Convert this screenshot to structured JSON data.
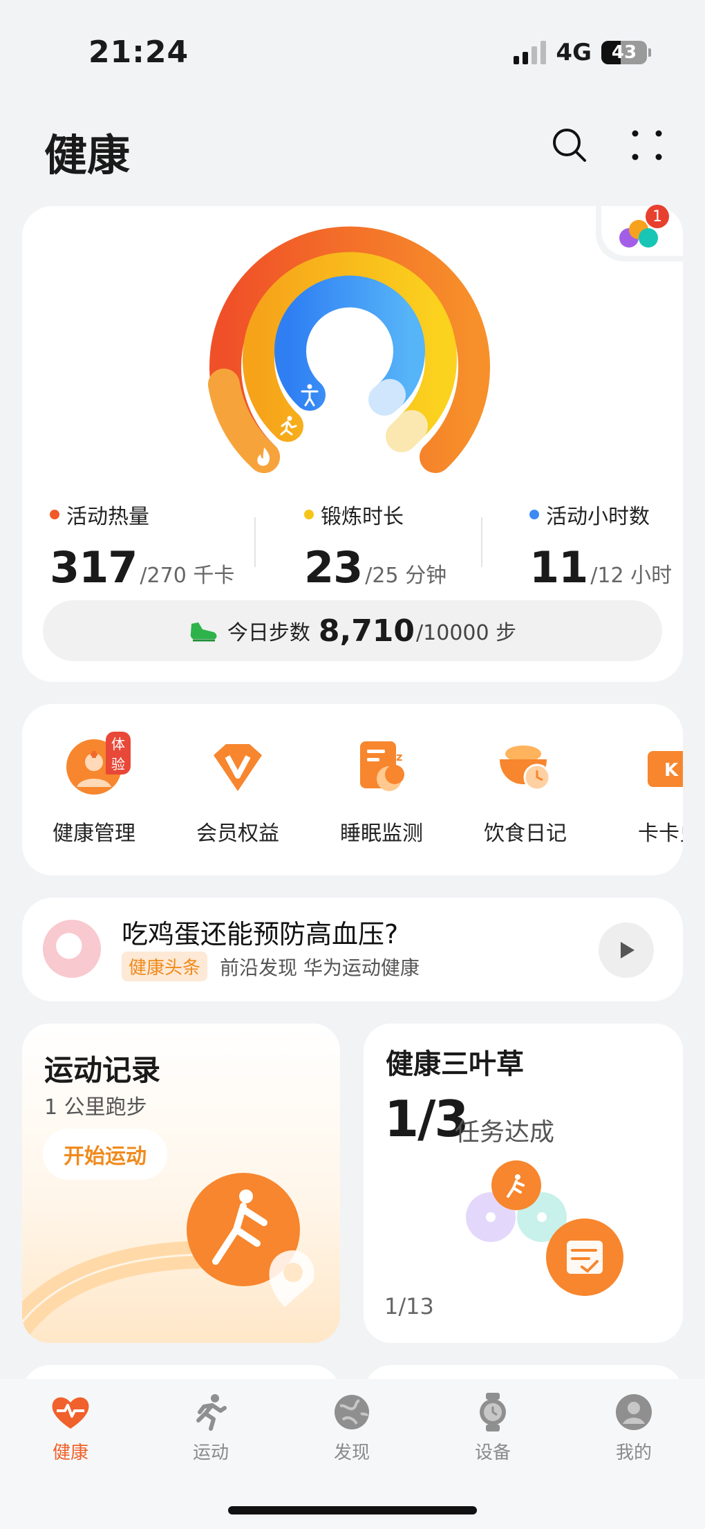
{
  "status": {
    "time": "21:24",
    "network": "4G",
    "battery": "43"
  },
  "header": {
    "title": "健康",
    "search_icon": "search-icon",
    "more_icon": "more-icon"
  },
  "activity": {
    "notification_count": "1",
    "calories": {
      "label": "活动热量",
      "value": "317",
      "goal": "/270 千卡",
      "color": "#f05a28"
    },
    "exercise": {
      "label": "锻炼时长",
      "value": "23",
      "goal": "/25 分钟",
      "color": "#f5c518"
    },
    "stand": {
      "label": "活动小时数",
      "value": "11",
      "goal": "/12 小时",
      "color": "#3d8af7"
    },
    "steps": {
      "label": "今日步数",
      "value": "8,710",
      "goal": "/10000 步"
    }
  },
  "services": [
    {
      "label": "健康管理",
      "tag": "体验",
      "icon": "health-manager-icon"
    },
    {
      "label": "会员权益",
      "icon": "vip-icon"
    },
    {
      "label": "睡眠监测",
      "icon": "sleep-icon"
    },
    {
      "label": "饮食日记",
      "icon": "diet-icon"
    },
    {
      "label": "卡卡兑",
      "icon": "card-icon"
    }
  ],
  "news": {
    "title": "吃鸡蛋还能预防高血压?",
    "tag": "健康头条",
    "source": "前沿发现 华为运动健康"
  },
  "sport_card": {
    "title": "运动记录",
    "subtitle": "1 公里跑步",
    "button": "开始运动"
  },
  "clover_card": {
    "title": "健康三叶草",
    "done": "1/3",
    "done_text": "任务达成",
    "page": "1/13"
  },
  "tabs": [
    {
      "label": "健康",
      "icon": "heart-pulse-icon",
      "active": true
    },
    {
      "label": "运动",
      "icon": "runner-icon"
    },
    {
      "label": "发现",
      "icon": "globe-icon"
    },
    {
      "label": "设备",
      "icon": "watch-icon"
    },
    {
      "label": "我的",
      "icon": "profile-icon"
    }
  ],
  "colors": {
    "accent": "#f0612b",
    "orange": "#f08a1c"
  }
}
